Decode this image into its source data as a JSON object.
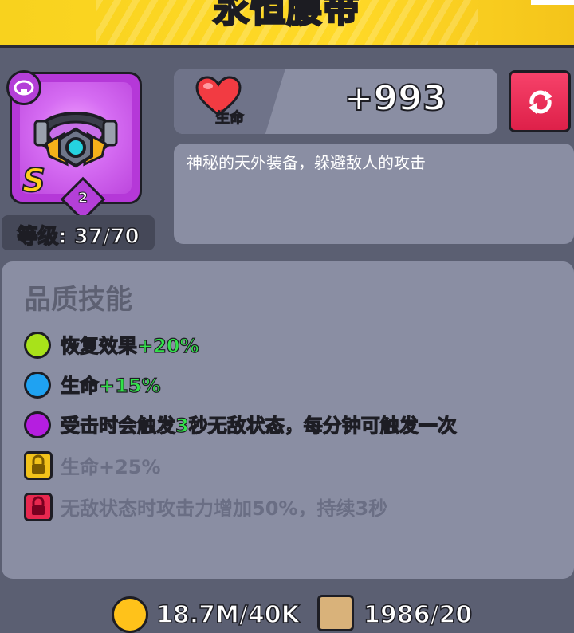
{
  "header": {
    "title": "永恒腰带"
  },
  "item": {
    "grade": "S",
    "stars": "2",
    "level_text": "等级: 37/70",
    "type_icon": "belt-type-icon",
    "frame_color": "#b538d8"
  },
  "stat": {
    "label": "生命",
    "value": "+993",
    "icon": "heart-icon"
  },
  "refresh_button": {
    "icon": "refresh-icon",
    "color": "#e8284f"
  },
  "description": "神秘的天外装备，躲避敌人的攻击",
  "skills": {
    "title": "品质技能",
    "items": [
      {
        "text": "恢复效果",
        "highlight": "+20%",
        "suffix": "",
        "color": "#a8e21a",
        "locked": false
      },
      {
        "text": "生命",
        "highlight": "+15%",
        "suffix": "",
        "color": "#1fa2f2",
        "locked": false
      },
      {
        "text": "受击时会触发",
        "highlight": "3",
        "suffix": "秒无敌状态，每分钟可触发一次",
        "color": "#b51ee0",
        "locked": false
      },
      {
        "text": "生命+25%",
        "highlight": "",
        "suffix": "",
        "color": "#f2c21a",
        "locked": true
      },
      {
        "text": "无敌状态时攻击力增加50%，持续3秒",
        "highlight": "",
        "suffix": "",
        "color": "#e8284f",
        "locked": true
      }
    ]
  },
  "footer": {
    "gold": "18.7M/40K",
    "scrolls": "1986/20"
  }
}
